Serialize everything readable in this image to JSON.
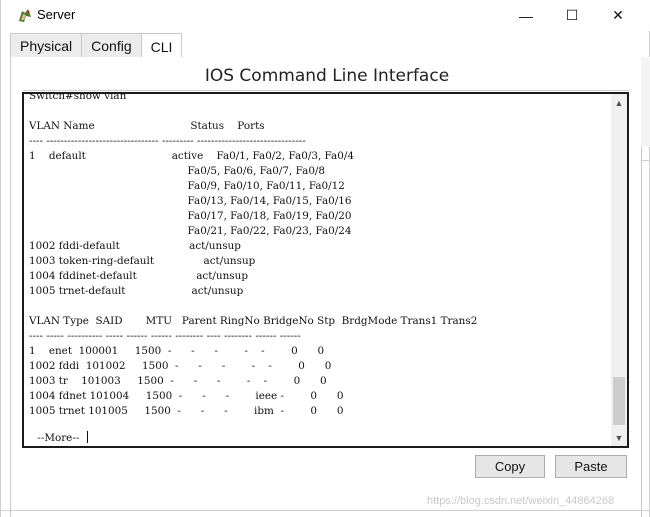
{
  "window": {
    "title": "Server",
    "app_icon": "packet-tracer-icon",
    "controls": {
      "minimize": "—",
      "maximize": "☐",
      "close": "✕"
    }
  },
  "tabs": [
    {
      "label": "Physical",
      "active": false
    },
    {
      "label": "Config",
      "active": false
    },
    {
      "label": "CLI",
      "active": true
    }
  ],
  "panel": {
    "heading": "IOS Command Line Interface"
  },
  "terminal": {
    "lines": [
      "Switch#show vlan",
      "",
      "VLAN Name                             Status    Ports",
      "---- -------------------------------- --------- -------------------------------",
      "1    default                          active    Fa0/1, Fa0/2, Fa0/3, Fa0/4",
      "                                                Fa0/5, Fa0/6, Fa0/7, Fa0/8",
      "                                                Fa0/9, Fa0/10, Fa0/11, Fa0/12",
      "                                                Fa0/13, Fa0/14, Fa0/15, Fa0/16",
      "                                                Fa0/17, Fa0/18, Fa0/19, Fa0/20",
      "                                                Fa0/21, Fa0/22, Fa0/23, Fa0/24",
      "1002 fddi-default                     act/unsup",
      "1003 token-ring-default               act/unsup",
      "1004 fddinet-default                  act/unsup",
      "1005 trnet-default                    act/unsup",
      "",
      "VLAN Type  SAID       MTU   Parent RingNo BridgeNo Stp  BrdgMode Trans1 Trans2",
      "---- ----- ---------- ----- ------ ------ -------- ---- -------- ------ ------",
      "1    enet  100001     1500  -      -      -        -    -        0      0",
      "1002 fddi  101002     1500  -      -      -        -    -        0      0",
      "1003 tr    101003     1500  -      -      -        -    -        0      0",
      "1004 fdnet 101004     1500  -      -      -        ieee -        0      0",
      "1005 trnet 101005     1500  -      -      -        ibm  -        0      0"
    ],
    "more_prompt": " --More-- "
  },
  "buttons": {
    "copy": "Copy",
    "paste": "Paste"
  },
  "watermark": "https://blog.csdn.net/weixin_44864268"
}
